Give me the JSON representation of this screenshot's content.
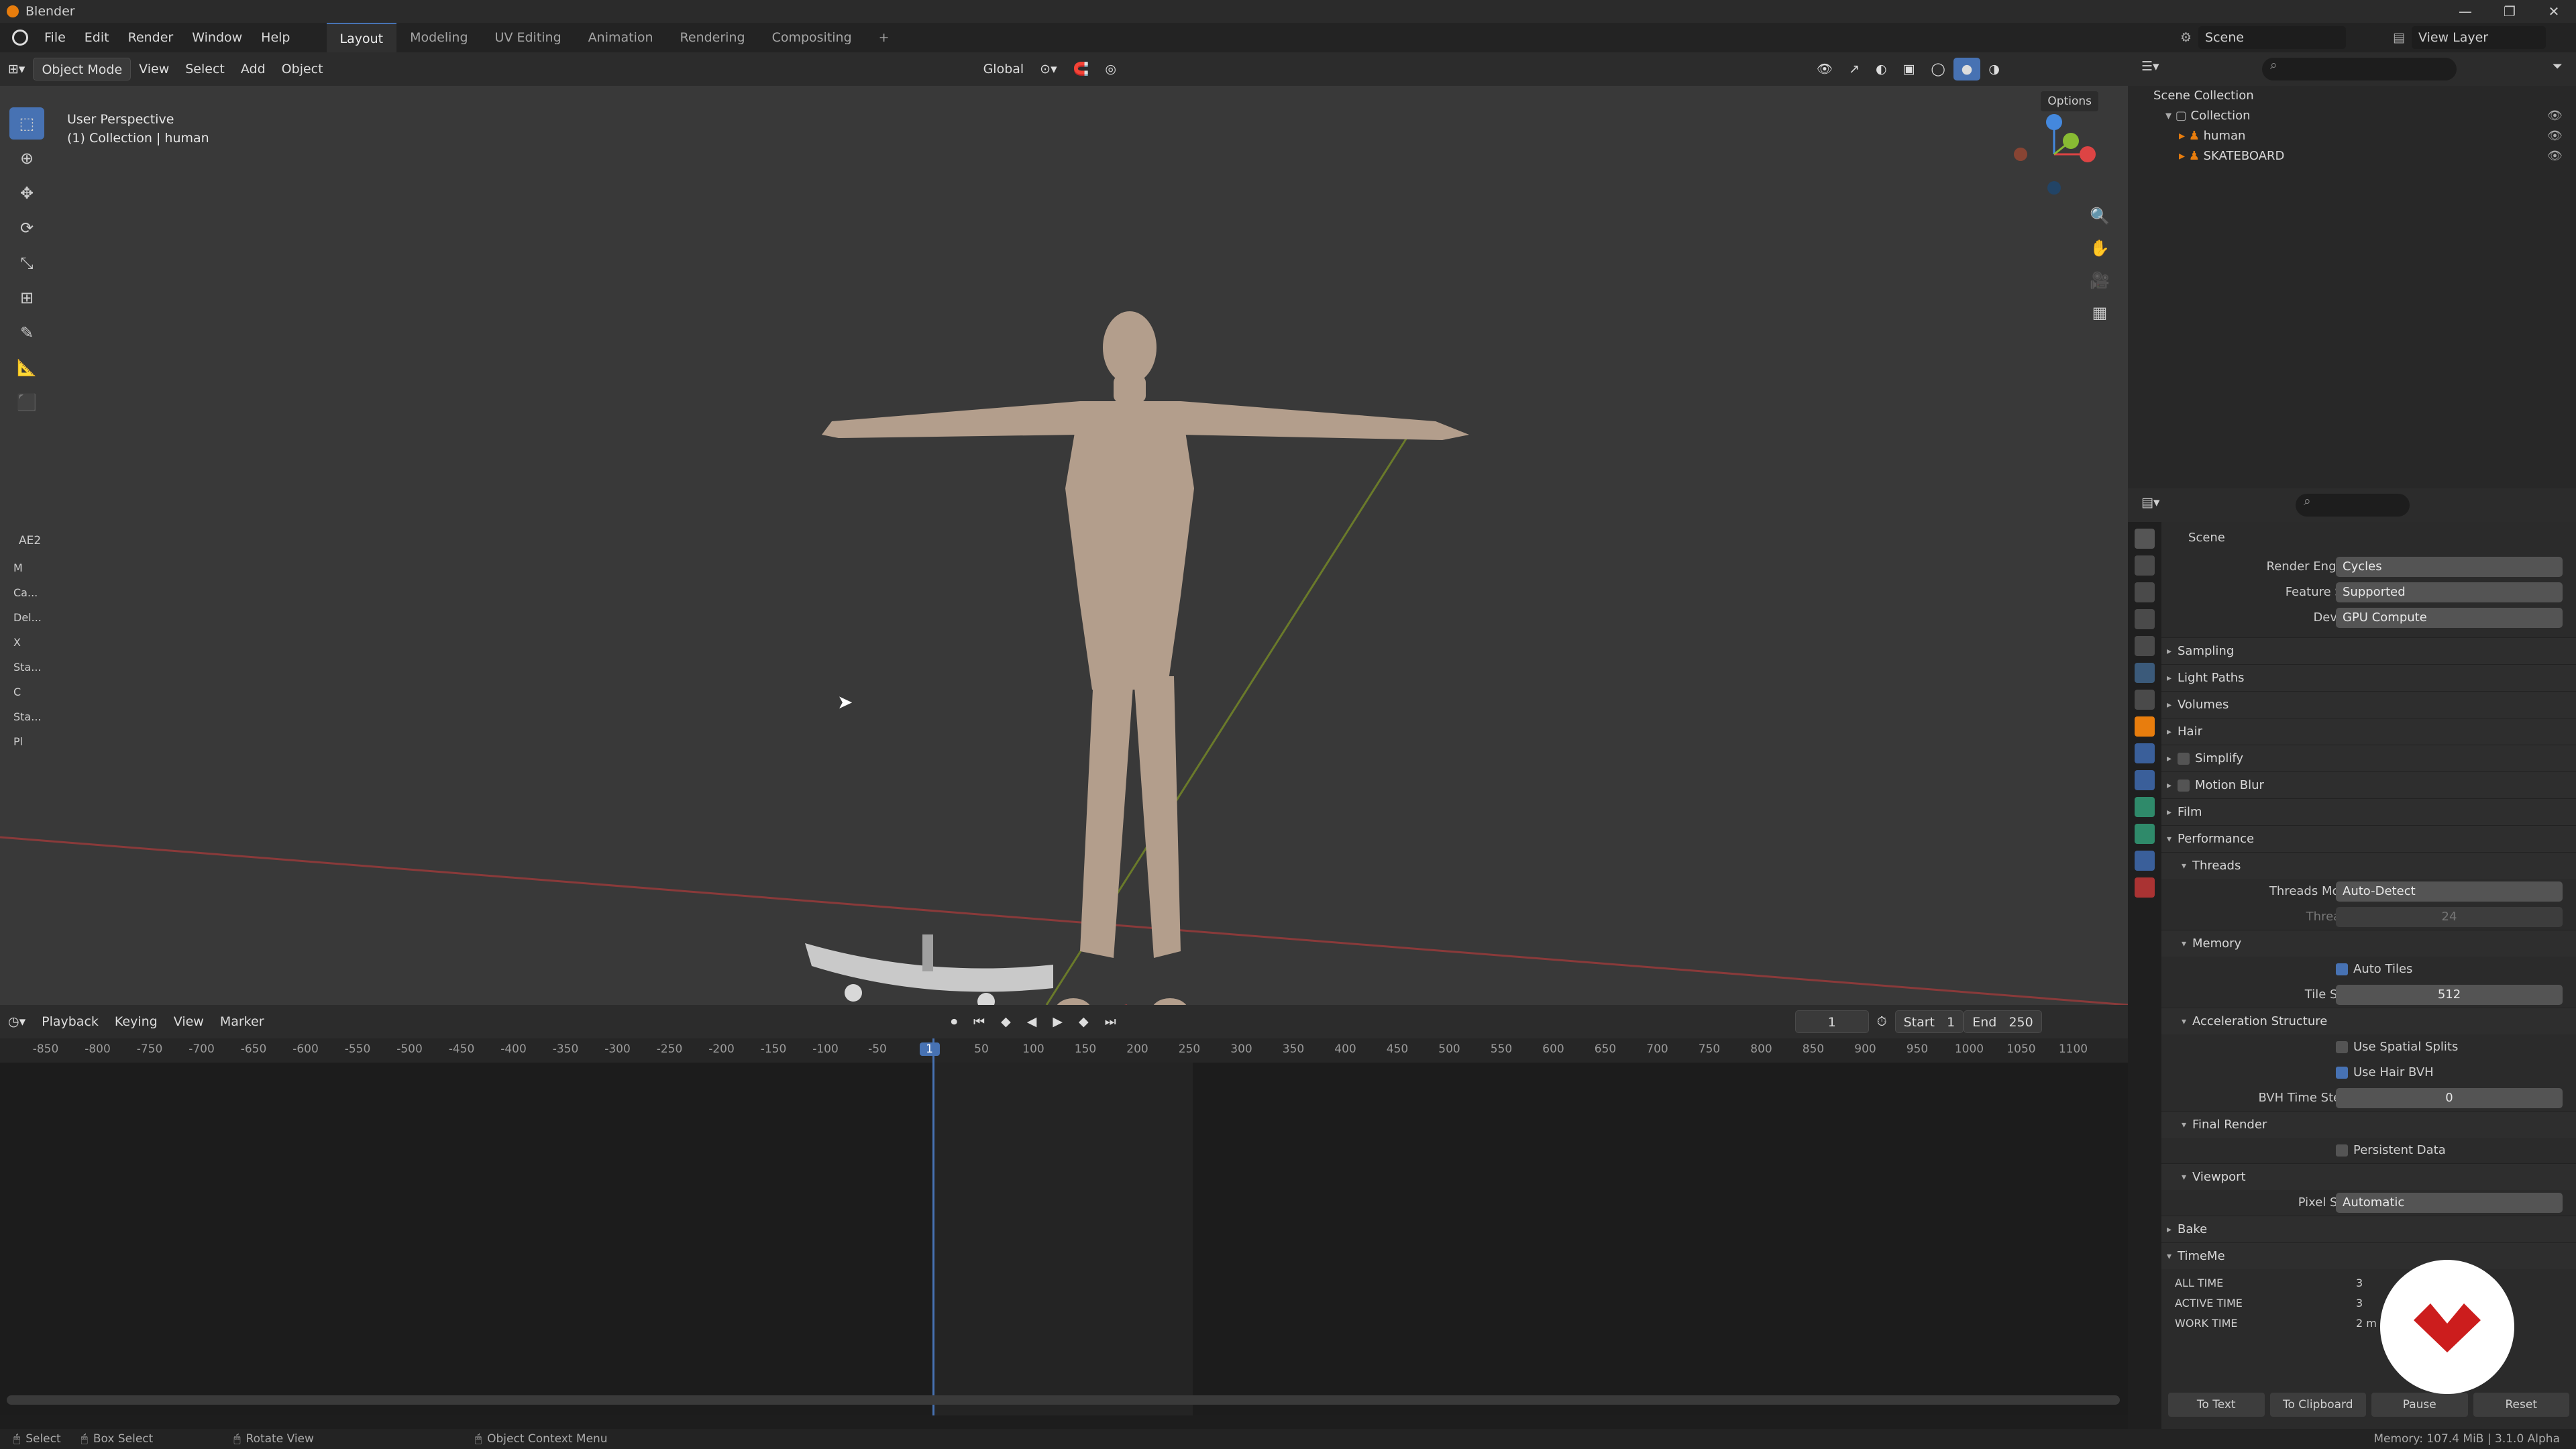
{
  "window": {
    "title": "Blender"
  },
  "menubar": {
    "items": [
      "File",
      "Edit",
      "Render",
      "Window",
      "Help"
    ],
    "workspaces": [
      "Layout",
      "Modeling",
      "UV Editing",
      "Animation",
      "Rendering",
      "Compositing"
    ],
    "add_tab": "+"
  },
  "scene_selector": {
    "scene": "Scene",
    "view_layer": "View Layer"
  },
  "viewport_header": {
    "mode": "Object Mode",
    "menus": [
      "View",
      "Select",
      "Add",
      "Object"
    ],
    "transform": "Global",
    "options": "Options"
  },
  "viewport": {
    "perspective": "User Perspective",
    "collection_info": "(1) Collection | human",
    "panel_label": "AE2",
    "side_labels": [
      "M",
      "Ca...",
      "Del...",
      "X",
      "Sta...",
      "C",
      "Sta...",
      "Pl"
    ]
  },
  "timeline": {
    "menus": [
      "Playback",
      "Keying",
      "View",
      "Marker"
    ],
    "current_frame": "1",
    "start_label": "Start",
    "start": "1",
    "end_label": "End",
    "end": "250",
    "ticks": [
      "-850",
      "-800",
      "-750",
      "-700",
      "-650",
      "-600",
      "-550",
      "-500",
      "-450",
      "-400",
      "-350",
      "-300",
      "-250",
      "-200",
      "-150",
      "-100",
      "-50",
      "1",
      "50",
      "100",
      "150",
      "200",
      "250",
      "300",
      "350",
      "400",
      "450",
      "500",
      "550",
      "600",
      "650",
      "700",
      "750",
      "800",
      "850",
      "900",
      "950",
      "1000",
      "1050",
      "1100"
    ]
  },
  "outliner": {
    "root": "Scene Collection",
    "collection": "Collection",
    "objects": [
      "human",
      "SKATEBOARD"
    ]
  },
  "properties": {
    "context": "Scene",
    "render_engine": {
      "label": "Render Engine",
      "value": "Cycles"
    },
    "feature_set": {
      "label": "Feature Set",
      "value": "Supported"
    },
    "device": {
      "label": "Device",
      "value": "GPU Compute"
    },
    "sections": [
      "Sampling",
      "Light Paths",
      "Volumes",
      "Hair",
      "Simplify",
      "Motion Blur",
      "Film",
      "Performance"
    ],
    "threads": {
      "title": "Threads",
      "mode_label": "Threads Mode",
      "mode": "Auto-Detect",
      "count_label": "Threads",
      "count": "24"
    },
    "memory": {
      "title": "Memory",
      "auto_tiles": "Auto Tiles",
      "tile_size_label": "Tile Size",
      "tile_size": "512"
    },
    "accel": {
      "title": "Acceleration Structure",
      "spatial": "Use Spatial Splits",
      "hair_bvh": "Use Hair BVH",
      "bvh_label": "BVH Time Steps",
      "bvh": "0"
    },
    "final_render": {
      "title": "Final Render",
      "persistent": "Persistent Data"
    },
    "viewport": {
      "title": "Viewport",
      "pixel_label": "Pixel Size",
      "pixel": "Automatic"
    },
    "bake": "Bake",
    "timeme": {
      "title": "TimeMe",
      "all": "ALL TIME",
      "active": "ACTIVE TIME",
      "work": "WORK TIME",
      "all_v": "3",
      "active_v": "3",
      "work_v": "2 m"
    },
    "buttons": [
      "To Text",
      "To Clipboard",
      "Pause",
      "Reset"
    ]
  },
  "status": {
    "select": "Select",
    "box_select": "Box Select",
    "rotate": "Rotate View",
    "context_menu": "Object Context Menu",
    "memory": "Memory: 107.4 MiB | 3.1.0 Alpha"
  },
  "colors": {
    "accent": "#4772b3",
    "orange": "#e87d0d",
    "badge_red": "#cc1d1d"
  }
}
